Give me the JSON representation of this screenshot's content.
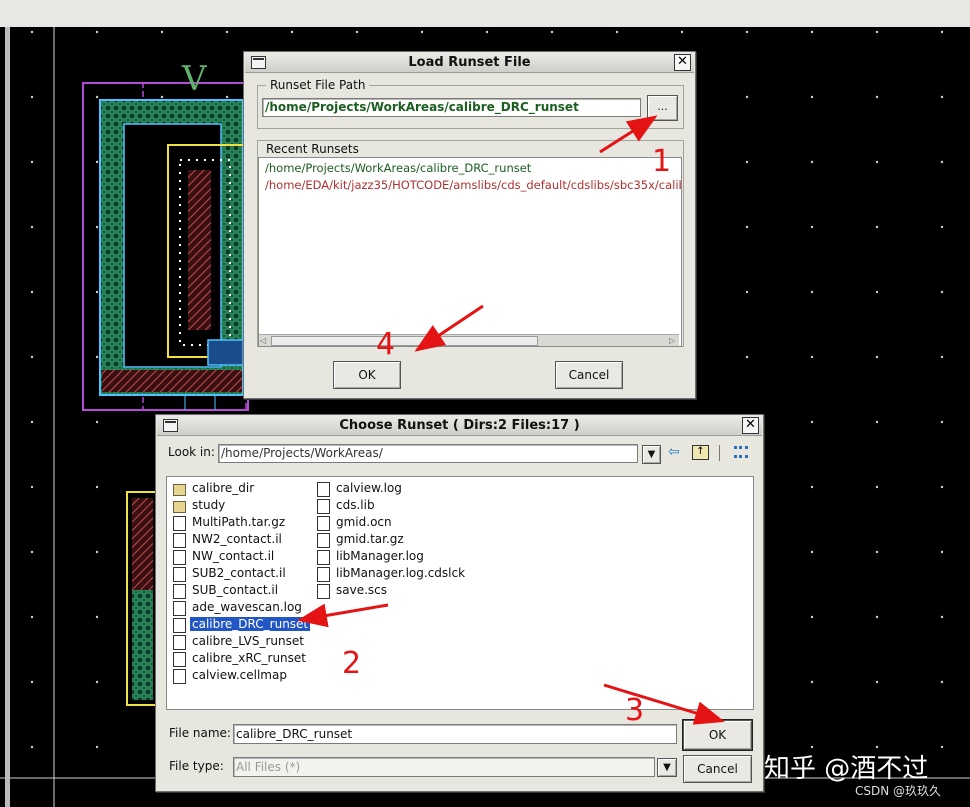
{
  "load_dialog": {
    "title": "Load Runset File",
    "path_group_label": "Runset File Path",
    "path_value": "/home/Projects/WorkAreas/calibre_DRC_runset",
    "browse_label": "...",
    "recent_label": "Recent Runsets",
    "recent": [
      {
        "path": "/home/Projects/WorkAreas/calibre_DRC_runset",
        "color": "#1b5e20"
      },
      {
        "path": "/home/EDA/kit/jazz35/HOTCODE/amslibs/cds_default/cdslibs/sbc35x/calib",
        "color": "#b03030"
      }
    ],
    "ok_label": "OK",
    "cancel_label": "Cancel"
  },
  "choose_dialog": {
    "title": "Choose Runset ( Dirs:2 Files:17 )",
    "lookin_label": "Look in:",
    "lookin_value": "/home/Projects/WorkAreas/",
    "files_col1": [
      {
        "name": "calibre_dir",
        "icon": "folder-icon"
      },
      {
        "name": "study",
        "icon": "folder-icon"
      },
      {
        "name": "MultiPath.tar.gz",
        "icon": "file-icon"
      },
      {
        "name": "NW2_contact.il",
        "icon": "file-icon"
      },
      {
        "name": "NW_contact.il",
        "icon": "file-icon"
      },
      {
        "name": "SUB2_contact.il",
        "icon": "file-icon"
      },
      {
        "name": "SUB_contact.il",
        "icon": "file-icon"
      },
      {
        "name": "ade_wavescan.log",
        "icon": "file-icon"
      },
      {
        "name": "calibre_DRC_runset",
        "icon": "file-icon",
        "selected": true
      },
      {
        "name": "calibre_LVS_runset",
        "icon": "file-icon"
      },
      {
        "name": "calibre_xRC_runset",
        "icon": "file-icon"
      },
      {
        "name": "calview.cellmap",
        "icon": "file-icon"
      }
    ],
    "files_col2": [
      {
        "name": "calview.log",
        "icon": "file-icon"
      },
      {
        "name": "cds.lib",
        "icon": "file-icon"
      },
      {
        "name": "gmid.ocn",
        "icon": "file-icon"
      },
      {
        "name": "gmid.tar.gz",
        "icon": "file-icon"
      },
      {
        "name": "libManager.log",
        "icon": "file-icon"
      },
      {
        "name": "libManager.log.cdslck",
        "icon": "file-icon"
      },
      {
        "name": "save.scs",
        "icon": "file-icon"
      }
    ],
    "filename_label": "File name:",
    "filename_value": "calibre_DRC_runset",
    "filetype_label": "File type:",
    "filetype_value": "All Files (*)",
    "ok_label": "OK",
    "cancel_label": "Cancel"
  },
  "annotations": {
    "n1": "1",
    "n2": "2",
    "n3": "3",
    "n4": "4",
    "color": "#e41414"
  },
  "watermark": {
    "main": "知乎 @酒不过",
    "sub": "CSDN @玖玖久"
  }
}
